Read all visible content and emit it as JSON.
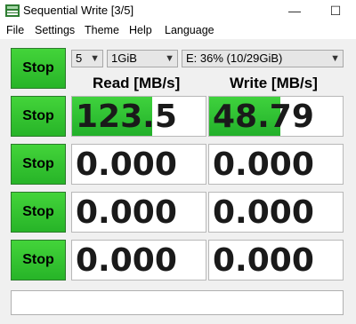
{
  "window": {
    "title": "Sequential Write [3/5]",
    "minimize_glyph": "—",
    "maximize_glyph": "☐",
    "close_glyph": "✕"
  },
  "menu": [
    "File",
    "Settings",
    "Theme",
    "Help",
    "Language"
  ],
  "controls": {
    "count": "5",
    "size": "1GiB",
    "drive": "E: 36% (10/29GiB)",
    "all_button": "Stop"
  },
  "headers": {
    "read": "Read [MB/s]",
    "write": "Write [MB/s]"
  },
  "rows": [
    {
      "button": "Stop",
      "read": "123.5",
      "write": "48.79",
      "read_fill": 0.6,
      "write_fill": 0.53
    },
    {
      "button": "Stop",
      "read": "0.000",
      "write": "0.000",
      "read_fill": 0,
      "write_fill": 0
    },
    {
      "button": "Stop",
      "read": "0.000",
      "write": "0.000",
      "read_fill": 0,
      "write_fill": 0
    },
    {
      "button": "Stop",
      "read": "0.000",
      "write": "0.000",
      "read_fill": 0,
      "write_fill": 0
    }
  ],
  "status_text": "",
  "colors": {
    "button_green": "#27b428",
    "bar_green": "#3fd23d"
  }
}
